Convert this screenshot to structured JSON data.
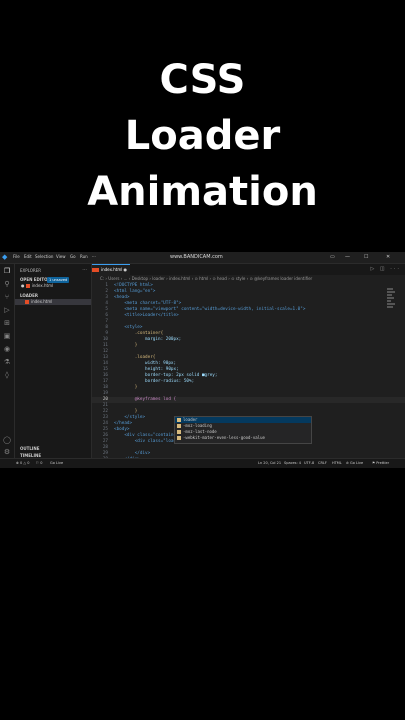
{
  "headline": [
    "CSS",
    "Loader",
    "Animation"
  ],
  "window": {
    "menu": [
      "File",
      "Edit",
      "Selection",
      "View",
      "Go",
      "Run",
      "···"
    ],
    "title": "www.BANDICAM.com"
  },
  "sidebar": {
    "title": "EXPLORER",
    "open_editors": "OPEN EDITORS",
    "unsaved_badge": "1 unsaved",
    "open_file": "index.html",
    "folder": "LOADER",
    "folder_file": "index.html",
    "outline": "OUTLINE",
    "timeline": "TIMELINE"
  },
  "tab": {
    "label": "index.html",
    "close": "●"
  },
  "breadcrumb": "C: › Users › ... › Desktop › loader › index.html › ⊙ html › ⊙ head › ⊙ style › ⊙ @keyframes loader identifier",
  "code": [
    {
      "n": "1",
      "t": "<!DOCTYPE html>"
    },
    {
      "n": "2",
      "t": "<html lang=\"en\">"
    },
    {
      "n": "3",
      "t": "<head>"
    },
    {
      "n": "4",
      "t": "    <meta charset=\"UTF-8\">"
    },
    {
      "n": "5",
      "t": "    <meta name=\"viewport\" content=\"width=device-width, initial-scale=1.0\">"
    },
    {
      "n": "6",
      "t": "    <title>Loader</title>"
    },
    {
      "n": "7",
      "t": ""
    },
    {
      "n": "8",
      "t": "    <style>"
    },
    {
      "n": "9",
      "t": "        .container{"
    },
    {
      "n": "10",
      "t": "            margin: 200px;"
    },
    {
      "n": "11",
      "t": "        }"
    },
    {
      "n": "12",
      "t": ""
    },
    {
      "n": "13",
      "t": "        .loader{"
    },
    {
      "n": "14",
      "t": "            width: 90px;"
    },
    {
      "n": "15",
      "t": "            height: 90px;"
    },
    {
      "n": "16",
      "t": "            border-top: 2px solid ■grey;"
    },
    {
      "n": "17",
      "t": "            border-radius: 50%;"
    },
    {
      "n": "18",
      "t": "        }"
    },
    {
      "n": "19",
      "t": ""
    },
    {
      "n": "20",
      "t": "        @keyframes lod {"
    },
    {
      "n": "21",
      "t": ""
    },
    {
      "n": "22",
      "t": "        }"
    },
    {
      "n": "23",
      "t": "    </style>"
    },
    {
      "n": "24",
      "t": "</head>"
    },
    {
      "n": "25",
      "t": "<body>"
    },
    {
      "n": "26",
      "t": "    <div class=\"container\">"
    },
    {
      "n": "27",
      "t": "        <div class=\"loader\">"
    },
    {
      "n": "28",
      "t": ""
    },
    {
      "n": "29",
      "t": "        </div>"
    },
    {
      "n": "30",
      "t": "    </div>"
    }
  ],
  "suggestions": [
    "loader",
    "-moz-loading",
    "-moz-last-node",
    "-webkit-mater-even-less-good-value"
  ],
  "status": {
    "left": [
      "⊗ 0 △ 0",
      "⚐ 0",
      "Go Live"
    ],
    "right": [
      "Ln 20, Col 21",
      "Spaces: 4",
      "UTF-8",
      "CRLF",
      "HTML",
      "⊘ Go Live",
      "⚑ Prettier"
    ]
  }
}
